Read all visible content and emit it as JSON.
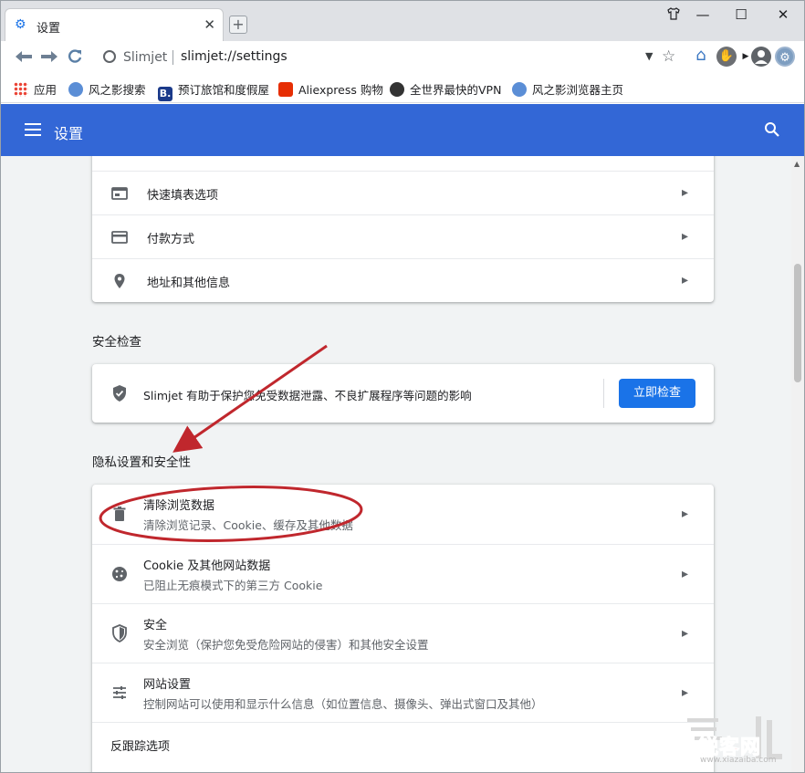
{
  "browser": {
    "tab_title": "设置",
    "tab_close": "✕",
    "new_tab": "+",
    "window_controls": {
      "minimize": "—",
      "maximize": "☐",
      "close": "✕"
    },
    "brand": "Slimjet",
    "url": "slimjet://settings"
  },
  "bookmarks": [
    {
      "label": "应用",
      "icon": "apps-icon"
    },
    {
      "label": "风之影搜索",
      "icon": "globe-icon"
    },
    {
      "label": "预订旅馆和度假屋",
      "icon": "booking-icon"
    },
    {
      "label": "Aliexpress 购物",
      "icon": "aliexpress-icon"
    },
    {
      "label": "全世界最快的VPN",
      "icon": "vpn-icon"
    },
    {
      "label": "风之影浏览器主页",
      "icon": "globe-icon"
    }
  ],
  "header": {
    "title": "设置"
  },
  "autofill": {
    "items": [
      {
        "label": "快速填表选项",
        "icon": "form-icon"
      },
      {
        "label": "付款方式",
        "icon": "credit-card-icon"
      },
      {
        "label": "地址和其他信息",
        "icon": "location-pin-icon"
      }
    ]
  },
  "safety_check": {
    "title": "安全检查",
    "description": "Slimjet 有助于保护您免受数据泄露、不良扩展程序等问题的影响",
    "button": "立即检查"
  },
  "privacy": {
    "title": "隐私设置和安全性",
    "items": [
      {
        "label": "清除浏览数据",
        "sub": "清除浏览记录、Cookie、缓存及其他数据",
        "icon": "trash-icon"
      },
      {
        "label": "Cookie 及其他网站数据",
        "sub": "已阻止无痕模式下的第三方 Cookie",
        "icon": "cookie-icon"
      },
      {
        "label": "安全",
        "sub": "安全浏览（保护您免受危险网站的侵害）和其他安全设置",
        "icon": "shield-icon"
      },
      {
        "label": "网站设置",
        "sub": "控制网站可以使用和显示什么信息（如位置信息、摄像头、弹出式窗口及其他）",
        "icon": "sliders-icon"
      }
    ],
    "tracking": "反跟踪选项"
  },
  "watermark": {
    "text": "锐客网",
    "sub": "www.xiazaiba.com"
  },
  "colors": {
    "header_blue": "#3367d6",
    "button_blue": "#1a73e8",
    "annotation_red": "#c0272d"
  }
}
